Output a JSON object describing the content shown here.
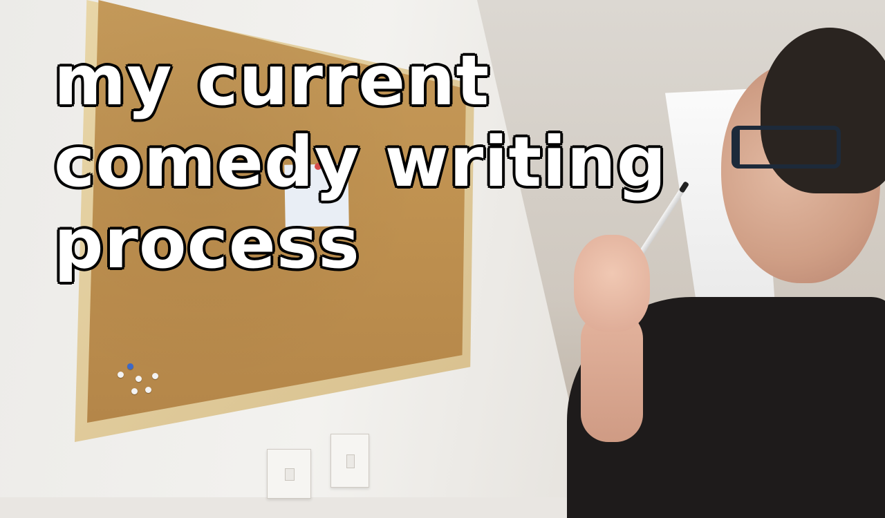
{
  "overlay_caption": {
    "lines": [
      "my current",
      "comedy writing",
      "process"
    ]
  },
  "scene": {
    "subjects": [
      "cork-board",
      "paper-note",
      "push-pins",
      "wall-switches",
      "person-with-pen",
      "roof-window"
    ]
  },
  "colors": {
    "caption_text": "#ffffff",
    "caption_outline": "#000000",
    "cork": "#c59a5a",
    "frame_wood": "#e2cf9e",
    "sweater": "#1e1b1b"
  }
}
